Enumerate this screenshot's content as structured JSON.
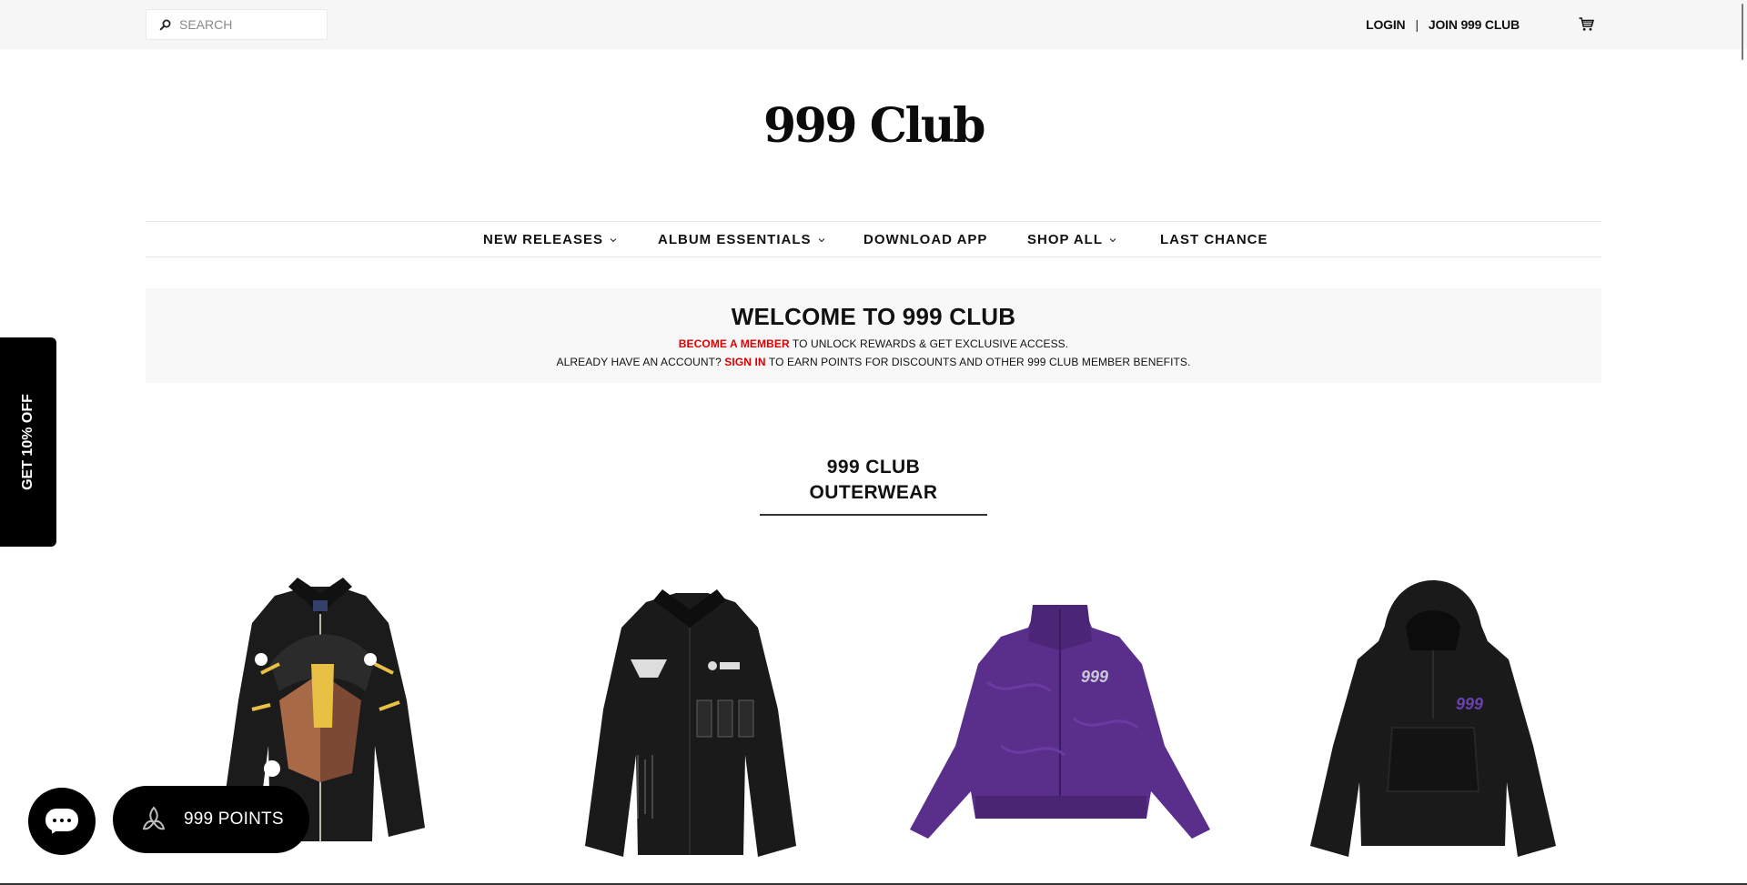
{
  "header": {
    "search_placeholder": "SEARCH",
    "login_label": "LOGIN",
    "separator": "|",
    "join_label": "JOIN 999 CLUB",
    "icons": {
      "search": "search-icon",
      "cart": "cart-icon"
    }
  },
  "logo": {
    "text": "999 Club"
  },
  "nav": {
    "items": [
      {
        "label": "NEW RELEASES",
        "has_dropdown": true
      },
      {
        "label": "ALBUM ESSENTIALS",
        "has_dropdown": true
      },
      {
        "label": "DOWNLOAD APP",
        "has_dropdown": false
      },
      {
        "label": "SHOP ALL",
        "has_dropdown": true
      },
      {
        "label": "LAST CHANCE",
        "has_dropdown": false
      }
    ]
  },
  "welcome": {
    "title": "WELCOME TO 999 CLUB",
    "line1_link": "BECOME A MEMBER",
    "line1_rest": " TO UNLOCK REWARDS & GET EXCLUSIVE ACCESS.",
    "line2_pre": "ALREADY HAVE AN ACCOUNT? ",
    "line2_link": "SIGN IN",
    "line2_rest": " TO EARN POINTS FOR DISCOUNTS AND OTHER 999 CLUB MEMBER BENEFITS.",
    "link_color": "#dd0000"
  },
  "section": {
    "title_line1": "999 CLUB",
    "title_line2": "OUTERWEAR"
  },
  "products": [
    {
      "image": "black work jacket with cartoon character graphic"
    },
    {
      "image": "black work jacket with white graphics"
    },
    {
      "image": "purple quilted jacket with 999 logo"
    },
    {
      "image": "black anorak with purple 999 logo"
    }
  ],
  "widgets": {
    "side_tab_label": "GET 10% OFF",
    "points_label": "999 POINTS",
    "chat_icon": "chat-icon",
    "points_icon": "rewards-logo-icon"
  }
}
